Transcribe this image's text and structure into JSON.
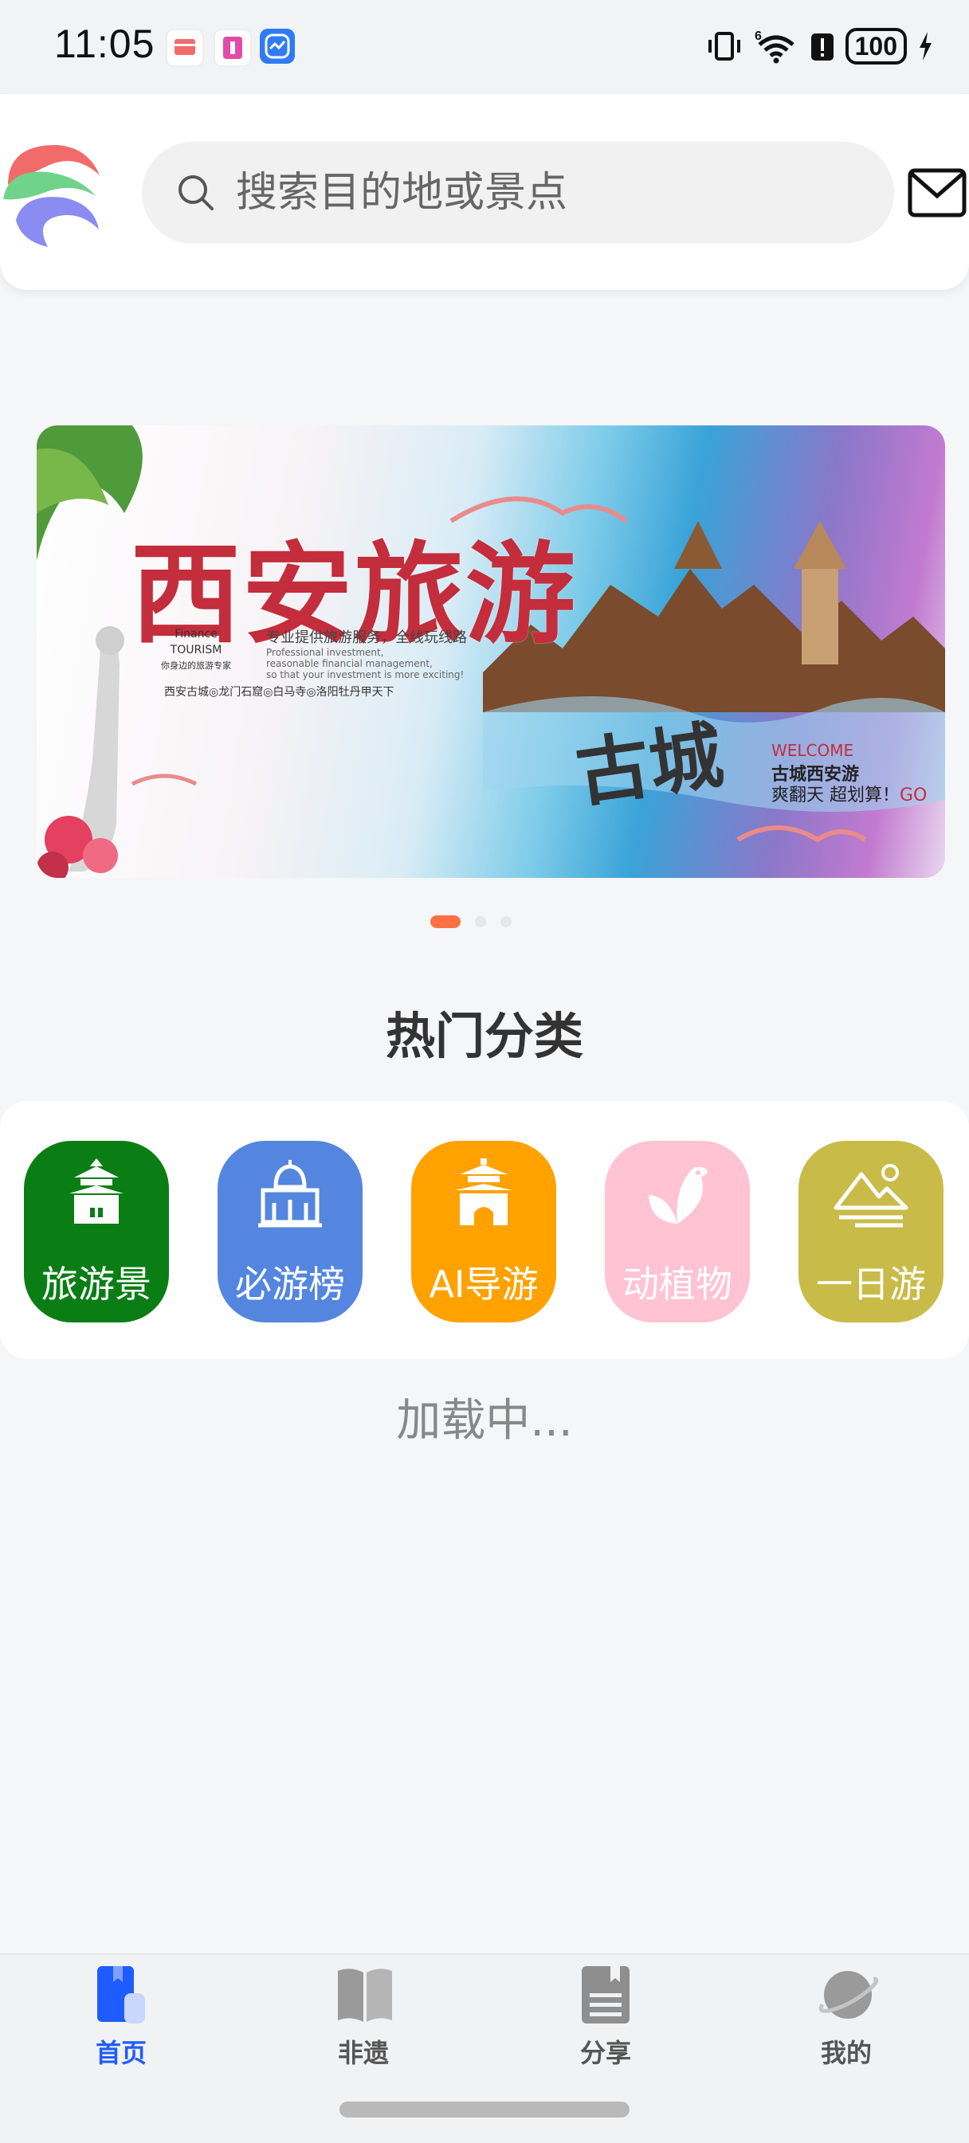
{
  "status_bar": {
    "time": "11:05",
    "battery": "100",
    "network": "6"
  },
  "search": {
    "placeholder": "搜索目的地或景点"
  },
  "banner": {
    "title": "西安旅游",
    "tag_top": "Finance",
    "tag_mid": "TOURISM",
    "tag_cn": "你身边的旅游专家",
    "subtitle": "专业提供旅游服务，全线玩线路",
    "small_en1": "Professional investment,",
    "small_en2": "reasonable financial management,",
    "small_en3": "so that your investment is more exciting!",
    "places": "西安古城◎龙门石窟◎白马寺◎洛阳牡丹甲天下",
    "brush_text": "古城",
    "welcome": "WELCOME",
    "line1": "古城西安游",
    "line2": "爽翻天 超划算！",
    "go": "GO"
  },
  "carousel": {
    "active_index": 0,
    "count": 3
  },
  "section_title": "热门分类",
  "categories": [
    {
      "label": "旅游景",
      "color": "#0a7e14",
      "icon": "temple-icon"
    },
    {
      "label": "必游榜",
      "color": "#5486e0",
      "icon": "mosque-icon"
    },
    {
      "label": "AI导游",
      "color": "#ffa200",
      "icon": "gate-icon"
    },
    {
      "label": "动植物",
      "color": "#ffc3d3",
      "icon": "leaf-bird-icon"
    },
    {
      "label": "一日游",
      "color": "#c9bb48",
      "icon": "mountain-icon"
    }
  ],
  "loading_text": "加载中...",
  "nav": [
    {
      "label": "首页",
      "icon": "bookmark-icon",
      "active": true
    },
    {
      "label": "非遗",
      "icon": "open-book-icon",
      "active": false
    },
    {
      "label": "分享",
      "icon": "document-icon",
      "active": false
    },
    {
      "label": "我的",
      "icon": "planet-icon",
      "active": false
    }
  ],
  "colors": {
    "accent": "#1f5cff",
    "dot_active": "#ff7043"
  }
}
